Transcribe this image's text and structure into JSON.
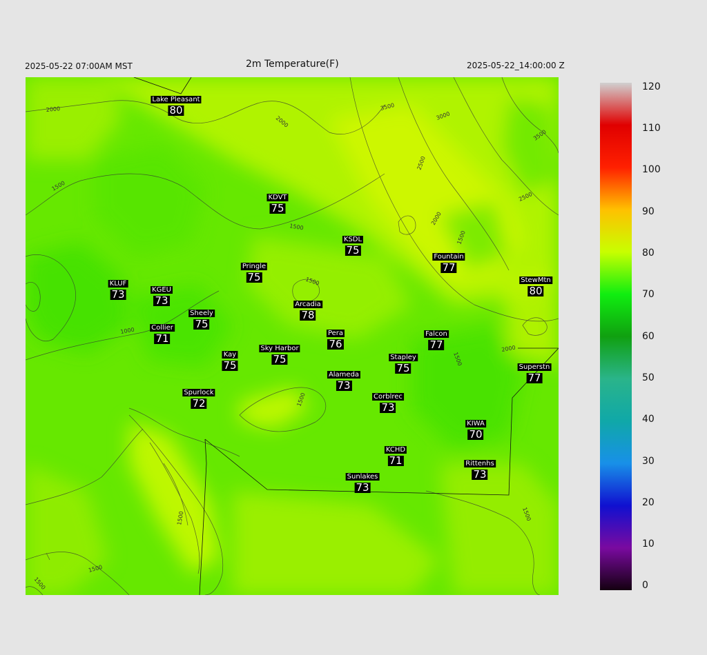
{
  "header": {
    "local_time": "2025-05-22 07:00AM MST",
    "title": "2m Temperature(F)",
    "utc_time": "2025-05-22_14:00:00 Z"
  },
  "stations": [
    {
      "name": "Lake Pleasant",
      "value": "80"
    },
    {
      "name": "KDVT",
      "value": "75"
    },
    {
      "name": "KSDL",
      "value": "75"
    },
    {
      "name": "Pringle",
      "value": "75"
    },
    {
      "name": "Fountain",
      "value": "77"
    },
    {
      "name": "KLUF",
      "value": "73"
    },
    {
      "name": "KGEU",
      "value": "73"
    },
    {
      "name": "StewMtn",
      "value": "80"
    },
    {
      "name": "Arcadia",
      "value": "78"
    },
    {
      "name": "Sheely",
      "value": "75"
    },
    {
      "name": "Collier",
      "value": "71"
    },
    {
      "name": "Pera",
      "value": "76"
    },
    {
      "name": "Falcon",
      "value": "77"
    },
    {
      "name": "Sky Harbor",
      "value": "75"
    },
    {
      "name": "Kay",
      "value": "75"
    },
    {
      "name": "Stapley",
      "value": "75"
    },
    {
      "name": "Superstn",
      "value": "77"
    },
    {
      "name": "Alameda",
      "value": "73"
    },
    {
      "name": "Spurlock",
      "value": "72"
    },
    {
      "name": "Corblrec",
      "value": "73"
    },
    {
      "name": "KIWA",
      "value": "70"
    },
    {
      "name": "KCHD",
      "value": "71"
    },
    {
      "name": "Rittenhs",
      "value": "73"
    },
    {
      "name": "Sunlakes",
      "value": "73"
    }
  ],
  "contour_labels": [
    "2000",
    "2000",
    "3500",
    "3000",
    "3500",
    "2500",
    "2000",
    "1500",
    "1500",
    "1500",
    "2500",
    "1500",
    "1000",
    "2000",
    "1500",
    "1500",
    "1500",
    "1500",
    "1500",
    "1500"
  ],
  "colorbar": {
    "ticks": [
      "120",
      "110",
      "100",
      "90",
      "80",
      "70",
      "60",
      "50",
      "40",
      "30",
      "20",
      "10",
      "0"
    ],
    "colors": {
      "0": "#140010",
      "10": "#7a0aa0",
      "20": "#1010d0",
      "30": "#1890e8",
      "40": "#10a8a8",
      "50": "#2ab48a",
      "60": "#10a010",
      "70": "#10ee10",
      "80": "#c8ff00",
      "90": "#ffc000",
      "100": "#ff2000",
      "110": "#e00000",
      "120": "#d0d0d0"
    }
  }
}
